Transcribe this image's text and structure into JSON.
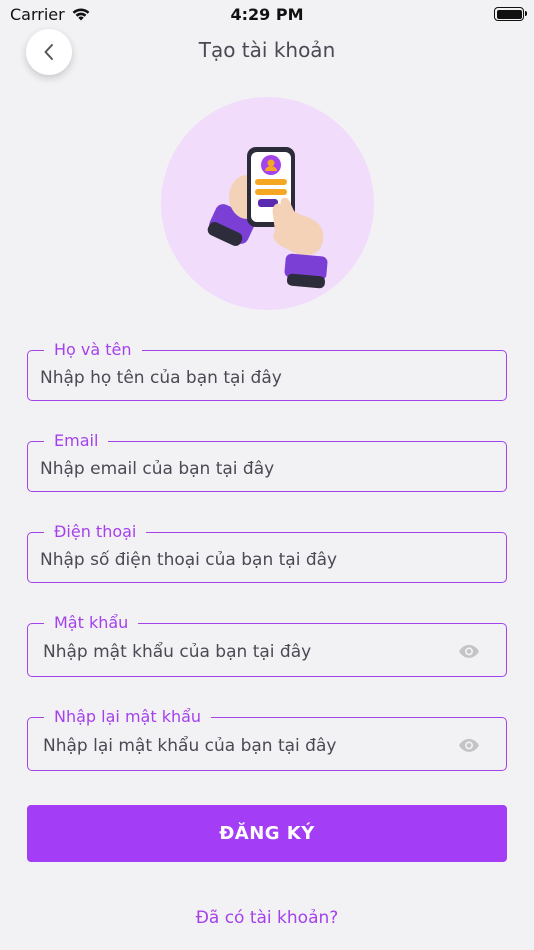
{
  "status_bar": {
    "carrier": "Carrier",
    "time": "4:29 PM",
    "wifi_icon": "wifi-icon",
    "battery_icon": "battery-full-icon"
  },
  "header": {
    "back_icon": "chevron-left-icon",
    "title": "Tạo tài khoản"
  },
  "illustration": {
    "icon": "phone-login-hand-illustration",
    "circle_color": "#f2dcfb"
  },
  "form": {
    "full_name": {
      "label": "Họ và tên",
      "placeholder": "Nhập họ tên của bạn tại đây",
      "value": ""
    },
    "email": {
      "label": "Email",
      "placeholder": "Nhập email của bạn tại đây",
      "value": ""
    },
    "phone": {
      "label": "Điện thoại",
      "placeholder": "Nhập số điện thoại của bạn tại đây",
      "value": ""
    },
    "password": {
      "label": "Mật khẩu",
      "placeholder": "Nhập mật khẩu của bạn tại đây",
      "value": "",
      "toggle_icon": "eye-icon"
    },
    "confirm_password": {
      "label": "Nhập lại mật khẩu",
      "placeholder": "Nhập lại mật khẩu của bạn tại đây",
      "value": "",
      "toggle_icon": "eye-icon"
    }
  },
  "submit_label": "ĐĂNG KÝ",
  "login_link": "Đã có tài khoản?",
  "colors": {
    "accent": "#a33ef6",
    "label": "#a541ec",
    "background": "#f2f2f4"
  }
}
